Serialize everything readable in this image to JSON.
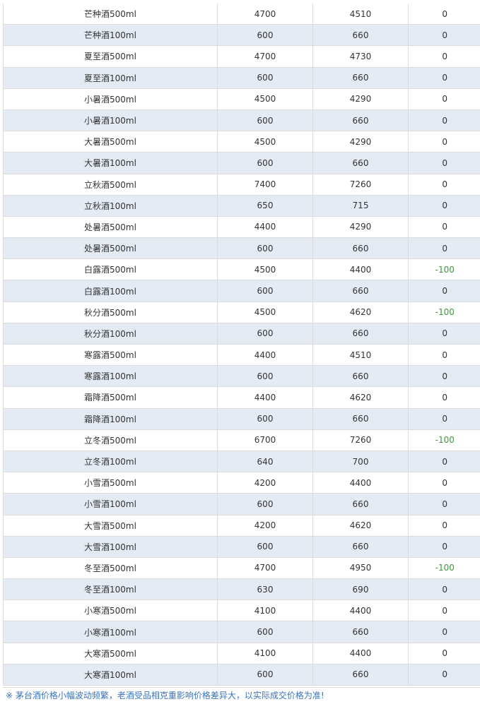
{
  "rows": [
    {
      "name": "芒种酒500ml",
      "v1": "4700",
      "v2": "4510",
      "change": "0"
    },
    {
      "name": "芒种酒100ml",
      "v1": "600",
      "v2": "660",
      "change": "0"
    },
    {
      "name": "夏至酒500ml",
      "v1": "4700",
      "v2": "4730",
      "change": "0"
    },
    {
      "name": "夏至酒100ml",
      "v1": "600",
      "v2": "660",
      "change": "0"
    },
    {
      "name": "小暑酒500ml",
      "v1": "4500",
      "v2": "4290",
      "change": "0"
    },
    {
      "name": "小暑酒100ml",
      "v1": "600",
      "v2": "660",
      "change": "0"
    },
    {
      "name": "大暑酒500ml",
      "v1": "4500",
      "v2": "4290",
      "change": "0"
    },
    {
      "name": "大暑酒100ml",
      "v1": "600",
      "v2": "660",
      "change": "0"
    },
    {
      "name": "立秋酒500ml",
      "v1": "7400",
      "v2": "7260",
      "change": "0"
    },
    {
      "name": "立秋酒100ml",
      "v1": "650",
      "v2": "715",
      "change": "0"
    },
    {
      "name": "处暑酒500ml",
      "v1": "4400",
      "v2": "4290",
      "change": "0"
    },
    {
      "name": "处暑酒500ml",
      "v1": "600",
      "v2": "660",
      "change": "0"
    },
    {
      "name": "白露酒500ml",
      "v1": "4500",
      "v2": "4400",
      "change": "-100"
    },
    {
      "name": "白露酒100ml",
      "v1": "600",
      "v2": "660",
      "change": "0"
    },
    {
      "name": "秋分酒500ml",
      "v1": "4500",
      "v2": "4620",
      "change": "-100"
    },
    {
      "name": "秋分酒100ml",
      "v1": "600",
      "v2": "660",
      "change": "0"
    },
    {
      "name": "寒露酒500ml",
      "v1": "4400",
      "v2": "4510",
      "change": "0"
    },
    {
      "name": "寒露酒100ml",
      "v1": "600",
      "v2": "660",
      "change": "0"
    },
    {
      "name": "霜降酒500ml",
      "v1": "4400",
      "v2": "4620",
      "change": "0"
    },
    {
      "name": "霜降酒100ml",
      "v1": "600",
      "v2": "660",
      "change": "0"
    },
    {
      "name": "立冬酒500ml",
      "v1": "6700",
      "v2": "7260",
      "change": "-100"
    },
    {
      "name": "立冬酒100ml",
      "v1": "640",
      "v2": "700",
      "change": "0"
    },
    {
      "name": "小雪酒500ml",
      "v1": "4200",
      "v2": "4400",
      "change": "0"
    },
    {
      "name": "小雪酒100ml",
      "v1": "600",
      "v2": "660",
      "change": "0"
    },
    {
      "name": "大雪酒500ml",
      "v1": "4200",
      "v2": "4620",
      "change": "0"
    },
    {
      "name": "大雪酒100ml",
      "v1": "600",
      "v2": "660",
      "change": "0"
    },
    {
      "name": "冬至酒500ml",
      "v1": "4700",
      "v2": "4950",
      "change": "-100"
    },
    {
      "name": "冬至酒100ml",
      "v1": "630",
      "v2": "690",
      "change": "0"
    },
    {
      "name": "小寒酒500ml",
      "v1": "4100",
      "v2": "4400",
      "change": "0"
    },
    {
      "name": "小寒酒100ml",
      "v1": "600",
      "v2": "660",
      "change": "0"
    },
    {
      "name": "大寒酒500ml",
      "v1": "4100",
      "v2": "4400",
      "change": "0"
    },
    {
      "name": "大寒酒100ml",
      "v1": "600",
      "v2": "660",
      "change": "0"
    }
  ],
  "footnote": "※ 茅台酒价格小幅波动频繁，老酒受品相克重影响价格差异大，以实际成交价格为准!",
  "colors": {
    "alt_row_bg": "#e4ebf5",
    "negative_change": "#3a9a3a",
    "footnote_text": "#3b73b9",
    "grid_line": "#dcdcdc"
  }
}
